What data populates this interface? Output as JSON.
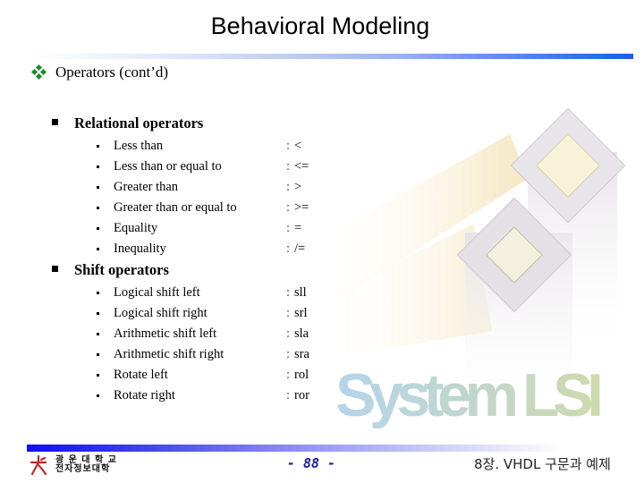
{
  "slide": {
    "title": "Behavioral Modeling",
    "heading": "Operators (cont’d)",
    "heading_icon": "diamond-cluster-icon",
    "sections": [
      {
        "title": "Relational operators",
        "items": [
          {
            "label": "Less than",
            "symbol": "<"
          },
          {
            "label": "Less than or equal to",
            "symbol": "<="
          },
          {
            "label": "Greater than",
            "symbol": ">"
          },
          {
            "label": "Greater than or equal to",
            "symbol": ">="
          },
          {
            "label": "Equality",
            "symbol": "="
          },
          {
            "label": "Inequality",
            "symbol": "/="
          }
        ]
      },
      {
        "title": "Shift operators",
        "items": [
          {
            "label": "Logical shift left",
            "symbol": "sll"
          },
          {
            "label": "Logical shift right",
            "symbol": "srl"
          },
          {
            "label": "Arithmetic shift left",
            "symbol": "sla"
          },
          {
            "label": "Arithmetic shift right",
            "symbol": "sra"
          },
          {
            "label": "Rotate left",
            "symbol": "rol"
          },
          {
            "label": "Rotate right",
            "symbol": "ror"
          }
        ]
      }
    ],
    "separator": ":",
    "background_art_text": "System LSI"
  },
  "footer": {
    "logo_line1": "광 운 대 학 교",
    "logo_line2": "전자정보대학",
    "page_number": "- 88 -",
    "chapter": "8장. VHDL 구문과 예제"
  },
  "colors": {
    "accent_blue": "#1560e8",
    "bullet_green": "#1e8c2c",
    "page_number": "#1a1aa0",
    "logo_red": "#c0282c"
  }
}
